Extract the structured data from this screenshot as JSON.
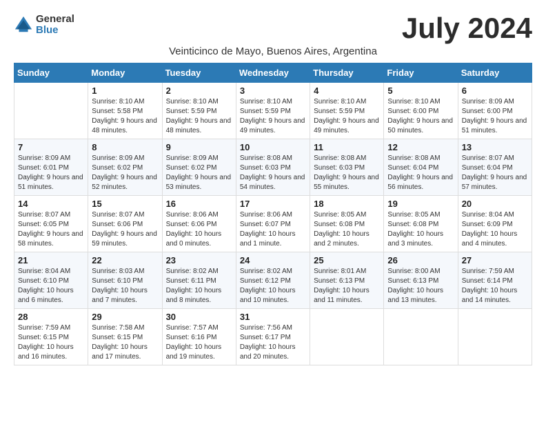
{
  "logo": {
    "general": "General",
    "blue": "Blue"
  },
  "title": "July 2024",
  "location": "Veinticinco de Mayo, Buenos Aires, Argentina",
  "days_of_week": [
    "Sunday",
    "Monday",
    "Tuesday",
    "Wednesday",
    "Thursday",
    "Friday",
    "Saturday"
  ],
  "weeks": [
    [
      {
        "day": "",
        "sunrise": "",
        "sunset": "",
        "daylight": ""
      },
      {
        "day": "1",
        "sunrise": "Sunrise: 8:10 AM",
        "sunset": "Sunset: 5:58 PM",
        "daylight": "Daylight: 9 hours and 48 minutes."
      },
      {
        "day": "2",
        "sunrise": "Sunrise: 8:10 AM",
        "sunset": "Sunset: 5:59 PM",
        "daylight": "Daylight: 9 hours and 48 minutes."
      },
      {
        "day": "3",
        "sunrise": "Sunrise: 8:10 AM",
        "sunset": "Sunset: 5:59 PM",
        "daylight": "Daylight: 9 hours and 49 minutes."
      },
      {
        "day": "4",
        "sunrise": "Sunrise: 8:10 AM",
        "sunset": "Sunset: 5:59 PM",
        "daylight": "Daylight: 9 hours and 49 minutes."
      },
      {
        "day": "5",
        "sunrise": "Sunrise: 8:10 AM",
        "sunset": "Sunset: 6:00 PM",
        "daylight": "Daylight: 9 hours and 50 minutes."
      },
      {
        "day": "6",
        "sunrise": "Sunrise: 8:09 AM",
        "sunset": "Sunset: 6:00 PM",
        "daylight": "Daylight: 9 hours and 51 minutes."
      }
    ],
    [
      {
        "day": "7",
        "sunrise": "Sunrise: 8:09 AM",
        "sunset": "Sunset: 6:01 PM",
        "daylight": "Daylight: 9 hours and 51 minutes."
      },
      {
        "day": "8",
        "sunrise": "Sunrise: 8:09 AM",
        "sunset": "Sunset: 6:02 PM",
        "daylight": "Daylight: 9 hours and 52 minutes."
      },
      {
        "day": "9",
        "sunrise": "Sunrise: 8:09 AM",
        "sunset": "Sunset: 6:02 PM",
        "daylight": "Daylight: 9 hours and 53 minutes."
      },
      {
        "day": "10",
        "sunrise": "Sunrise: 8:08 AM",
        "sunset": "Sunset: 6:03 PM",
        "daylight": "Daylight: 9 hours and 54 minutes."
      },
      {
        "day": "11",
        "sunrise": "Sunrise: 8:08 AM",
        "sunset": "Sunset: 6:03 PM",
        "daylight": "Daylight: 9 hours and 55 minutes."
      },
      {
        "day": "12",
        "sunrise": "Sunrise: 8:08 AM",
        "sunset": "Sunset: 6:04 PM",
        "daylight": "Daylight: 9 hours and 56 minutes."
      },
      {
        "day": "13",
        "sunrise": "Sunrise: 8:07 AM",
        "sunset": "Sunset: 6:04 PM",
        "daylight": "Daylight: 9 hours and 57 minutes."
      }
    ],
    [
      {
        "day": "14",
        "sunrise": "Sunrise: 8:07 AM",
        "sunset": "Sunset: 6:05 PM",
        "daylight": "Daylight: 9 hours and 58 minutes."
      },
      {
        "day": "15",
        "sunrise": "Sunrise: 8:07 AM",
        "sunset": "Sunset: 6:06 PM",
        "daylight": "Daylight: 9 hours and 59 minutes."
      },
      {
        "day": "16",
        "sunrise": "Sunrise: 8:06 AM",
        "sunset": "Sunset: 6:06 PM",
        "daylight": "Daylight: 10 hours and 0 minutes."
      },
      {
        "day": "17",
        "sunrise": "Sunrise: 8:06 AM",
        "sunset": "Sunset: 6:07 PM",
        "daylight": "Daylight: 10 hours and 1 minute."
      },
      {
        "day": "18",
        "sunrise": "Sunrise: 8:05 AM",
        "sunset": "Sunset: 6:08 PM",
        "daylight": "Daylight: 10 hours and 2 minutes."
      },
      {
        "day": "19",
        "sunrise": "Sunrise: 8:05 AM",
        "sunset": "Sunset: 6:08 PM",
        "daylight": "Daylight: 10 hours and 3 minutes."
      },
      {
        "day": "20",
        "sunrise": "Sunrise: 8:04 AM",
        "sunset": "Sunset: 6:09 PM",
        "daylight": "Daylight: 10 hours and 4 minutes."
      }
    ],
    [
      {
        "day": "21",
        "sunrise": "Sunrise: 8:04 AM",
        "sunset": "Sunset: 6:10 PM",
        "daylight": "Daylight: 10 hours and 6 minutes."
      },
      {
        "day": "22",
        "sunrise": "Sunrise: 8:03 AM",
        "sunset": "Sunset: 6:10 PM",
        "daylight": "Daylight: 10 hours and 7 minutes."
      },
      {
        "day": "23",
        "sunrise": "Sunrise: 8:02 AM",
        "sunset": "Sunset: 6:11 PM",
        "daylight": "Daylight: 10 hours and 8 minutes."
      },
      {
        "day": "24",
        "sunrise": "Sunrise: 8:02 AM",
        "sunset": "Sunset: 6:12 PM",
        "daylight": "Daylight: 10 hours and 10 minutes."
      },
      {
        "day": "25",
        "sunrise": "Sunrise: 8:01 AM",
        "sunset": "Sunset: 6:13 PM",
        "daylight": "Daylight: 10 hours and 11 minutes."
      },
      {
        "day": "26",
        "sunrise": "Sunrise: 8:00 AM",
        "sunset": "Sunset: 6:13 PM",
        "daylight": "Daylight: 10 hours and 13 minutes."
      },
      {
        "day": "27",
        "sunrise": "Sunrise: 7:59 AM",
        "sunset": "Sunset: 6:14 PM",
        "daylight": "Daylight: 10 hours and 14 minutes."
      }
    ],
    [
      {
        "day": "28",
        "sunrise": "Sunrise: 7:59 AM",
        "sunset": "Sunset: 6:15 PM",
        "daylight": "Daylight: 10 hours and 16 minutes."
      },
      {
        "day": "29",
        "sunrise": "Sunrise: 7:58 AM",
        "sunset": "Sunset: 6:15 PM",
        "daylight": "Daylight: 10 hours and 17 minutes."
      },
      {
        "day": "30",
        "sunrise": "Sunrise: 7:57 AM",
        "sunset": "Sunset: 6:16 PM",
        "daylight": "Daylight: 10 hours and 19 minutes."
      },
      {
        "day": "31",
        "sunrise": "Sunrise: 7:56 AM",
        "sunset": "Sunset: 6:17 PM",
        "daylight": "Daylight: 10 hours and 20 minutes."
      },
      {
        "day": "",
        "sunrise": "",
        "sunset": "",
        "daylight": ""
      },
      {
        "day": "",
        "sunrise": "",
        "sunset": "",
        "daylight": ""
      },
      {
        "day": "",
        "sunrise": "",
        "sunset": "",
        "daylight": ""
      }
    ]
  ]
}
